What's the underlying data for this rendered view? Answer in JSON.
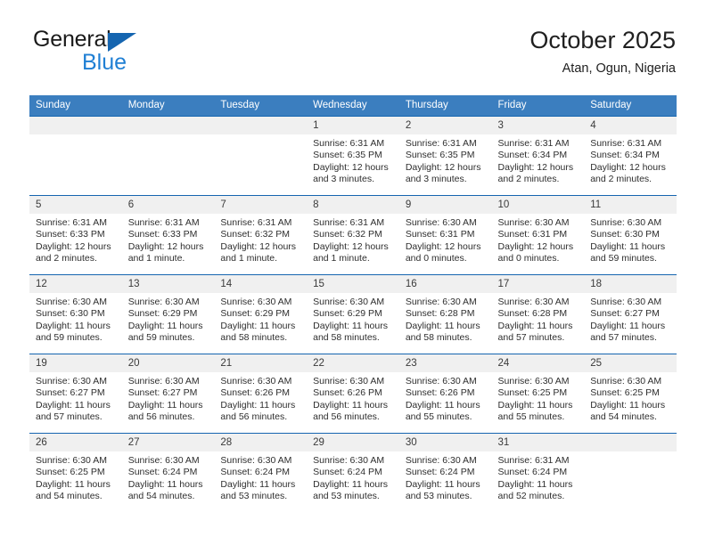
{
  "brand": {
    "line1": "General",
    "line2": "Blue",
    "triangle_color": "#1565b0",
    "blue_text_color": "#1f7fd4"
  },
  "header": {
    "title": "October 2025",
    "subtitle": "Atan, Ogun, Nigeria"
  },
  "theme": {
    "header_row_bg": "#3b7ebf",
    "row_divider": "#1565b0",
    "daynum_bg": "#f0f0f0",
    "text": "#2e2e2e"
  },
  "weekdays": [
    "Sunday",
    "Monday",
    "Tuesday",
    "Wednesday",
    "Thursday",
    "Friday",
    "Saturday"
  ],
  "weeks": [
    [
      {
        "day": "",
        "lines": []
      },
      {
        "day": "",
        "lines": []
      },
      {
        "day": "",
        "lines": []
      },
      {
        "day": "1",
        "lines": [
          "Sunrise: 6:31 AM",
          "Sunset: 6:35 PM",
          "Daylight: 12 hours",
          "and 3 minutes."
        ]
      },
      {
        "day": "2",
        "lines": [
          "Sunrise: 6:31 AM",
          "Sunset: 6:35 PM",
          "Daylight: 12 hours",
          "and 3 minutes."
        ]
      },
      {
        "day": "3",
        "lines": [
          "Sunrise: 6:31 AM",
          "Sunset: 6:34 PM",
          "Daylight: 12 hours",
          "and 2 minutes."
        ]
      },
      {
        "day": "4",
        "lines": [
          "Sunrise: 6:31 AM",
          "Sunset: 6:34 PM",
          "Daylight: 12 hours",
          "and 2 minutes."
        ]
      }
    ],
    [
      {
        "day": "5",
        "lines": [
          "Sunrise: 6:31 AM",
          "Sunset: 6:33 PM",
          "Daylight: 12 hours",
          "and 2 minutes."
        ]
      },
      {
        "day": "6",
        "lines": [
          "Sunrise: 6:31 AM",
          "Sunset: 6:33 PM",
          "Daylight: 12 hours",
          "and 1 minute."
        ]
      },
      {
        "day": "7",
        "lines": [
          "Sunrise: 6:31 AM",
          "Sunset: 6:32 PM",
          "Daylight: 12 hours",
          "and 1 minute."
        ]
      },
      {
        "day": "8",
        "lines": [
          "Sunrise: 6:31 AM",
          "Sunset: 6:32 PM",
          "Daylight: 12 hours",
          "and 1 minute."
        ]
      },
      {
        "day": "9",
        "lines": [
          "Sunrise: 6:30 AM",
          "Sunset: 6:31 PM",
          "Daylight: 12 hours",
          "and 0 minutes."
        ]
      },
      {
        "day": "10",
        "lines": [
          "Sunrise: 6:30 AM",
          "Sunset: 6:31 PM",
          "Daylight: 12 hours",
          "and 0 minutes."
        ]
      },
      {
        "day": "11",
        "lines": [
          "Sunrise: 6:30 AM",
          "Sunset: 6:30 PM",
          "Daylight: 11 hours",
          "and 59 minutes."
        ]
      }
    ],
    [
      {
        "day": "12",
        "lines": [
          "Sunrise: 6:30 AM",
          "Sunset: 6:30 PM",
          "Daylight: 11 hours",
          "and 59 minutes."
        ]
      },
      {
        "day": "13",
        "lines": [
          "Sunrise: 6:30 AM",
          "Sunset: 6:29 PM",
          "Daylight: 11 hours",
          "and 59 minutes."
        ]
      },
      {
        "day": "14",
        "lines": [
          "Sunrise: 6:30 AM",
          "Sunset: 6:29 PM",
          "Daylight: 11 hours",
          "and 58 minutes."
        ]
      },
      {
        "day": "15",
        "lines": [
          "Sunrise: 6:30 AM",
          "Sunset: 6:29 PM",
          "Daylight: 11 hours",
          "and 58 minutes."
        ]
      },
      {
        "day": "16",
        "lines": [
          "Sunrise: 6:30 AM",
          "Sunset: 6:28 PM",
          "Daylight: 11 hours",
          "and 58 minutes."
        ]
      },
      {
        "day": "17",
        "lines": [
          "Sunrise: 6:30 AM",
          "Sunset: 6:28 PM",
          "Daylight: 11 hours",
          "and 57 minutes."
        ]
      },
      {
        "day": "18",
        "lines": [
          "Sunrise: 6:30 AM",
          "Sunset: 6:27 PM",
          "Daylight: 11 hours",
          "and 57 minutes."
        ]
      }
    ],
    [
      {
        "day": "19",
        "lines": [
          "Sunrise: 6:30 AM",
          "Sunset: 6:27 PM",
          "Daylight: 11 hours",
          "and 57 minutes."
        ]
      },
      {
        "day": "20",
        "lines": [
          "Sunrise: 6:30 AM",
          "Sunset: 6:27 PM",
          "Daylight: 11 hours",
          "and 56 minutes."
        ]
      },
      {
        "day": "21",
        "lines": [
          "Sunrise: 6:30 AM",
          "Sunset: 6:26 PM",
          "Daylight: 11 hours",
          "and 56 minutes."
        ]
      },
      {
        "day": "22",
        "lines": [
          "Sunrise: 6:30 AM",
          "Sunset: 6:26 PM",
          "Daylight: 11 hours",
          "and 56 minutes."
        ]
      },
      {
        "day": "23",
        "lines": [
          "Sunrise: 6:30 AM",
          "Sunset: 6:26 PM",
          "Daylight: 11 hours",
          "and 55 minutes."
        ]
      },
      {
        "day": "24",
        "lines": [
          "Sunrise: 6:30 AM",
          "Sunset: 6:25 PM",
          "Daylight: 11 hours",
          "and 55 minutes."
        ]
      },
      {
        "day": "25",
        "lines": [
          "Sunrise: 6:30 AM",
          "Sunset: 6:25 PM",
          "Daylight: 11 hours",
          "and 54 minutes."
        ]
      }
    ],
    [
      {
        "day": "26",
        "lines": [
          "Sunrise: 6:30 AM",
          "Sunset: 6:25 PM",
          "Daylight: 11 hours",
          "and 54 minutes."
        ]
      },
      {
        "day": "27",
        "lines": [
          "Sunrise: 6:30 AM",
          "Sunset: 6:24 PM",
          "Daylight: 11 hours",
          "and 54 minutes."
        ]
      },
      {
        "day": "28",
        "lines": [
          "Sunrise: 6:30 AM",
          "Sunset: 6:24 PM",
          "Daylight: 11 hours",
          "and 53 minutes."
        ]
      },
      {
        "day": "29",
        "lines": [
          "Sunrise: 6:30 AM",
          "Sunset: 6:24 PM",
          "Daylight: 11 hours",
          "and 53 minutes."
        ]
      },
      {
        "day": "30",
        "lines": [
          "Sunrise: 6:30 AM",
          "Sunset: 6:24 PM",
          "Daylight: 11 hours",
          "and 53 minutes."
        ]
      },
      {
        "day": "31",
        "lines": [
          "Sunrise: 6:31 AM",
          "Sunset: 6:24 PM",
          "Daylight: 11 hours",
          "and 52 minutes."
        ]
      },
      {
        "day": "",
        "lines": []
      }
    ]
  ]
}
